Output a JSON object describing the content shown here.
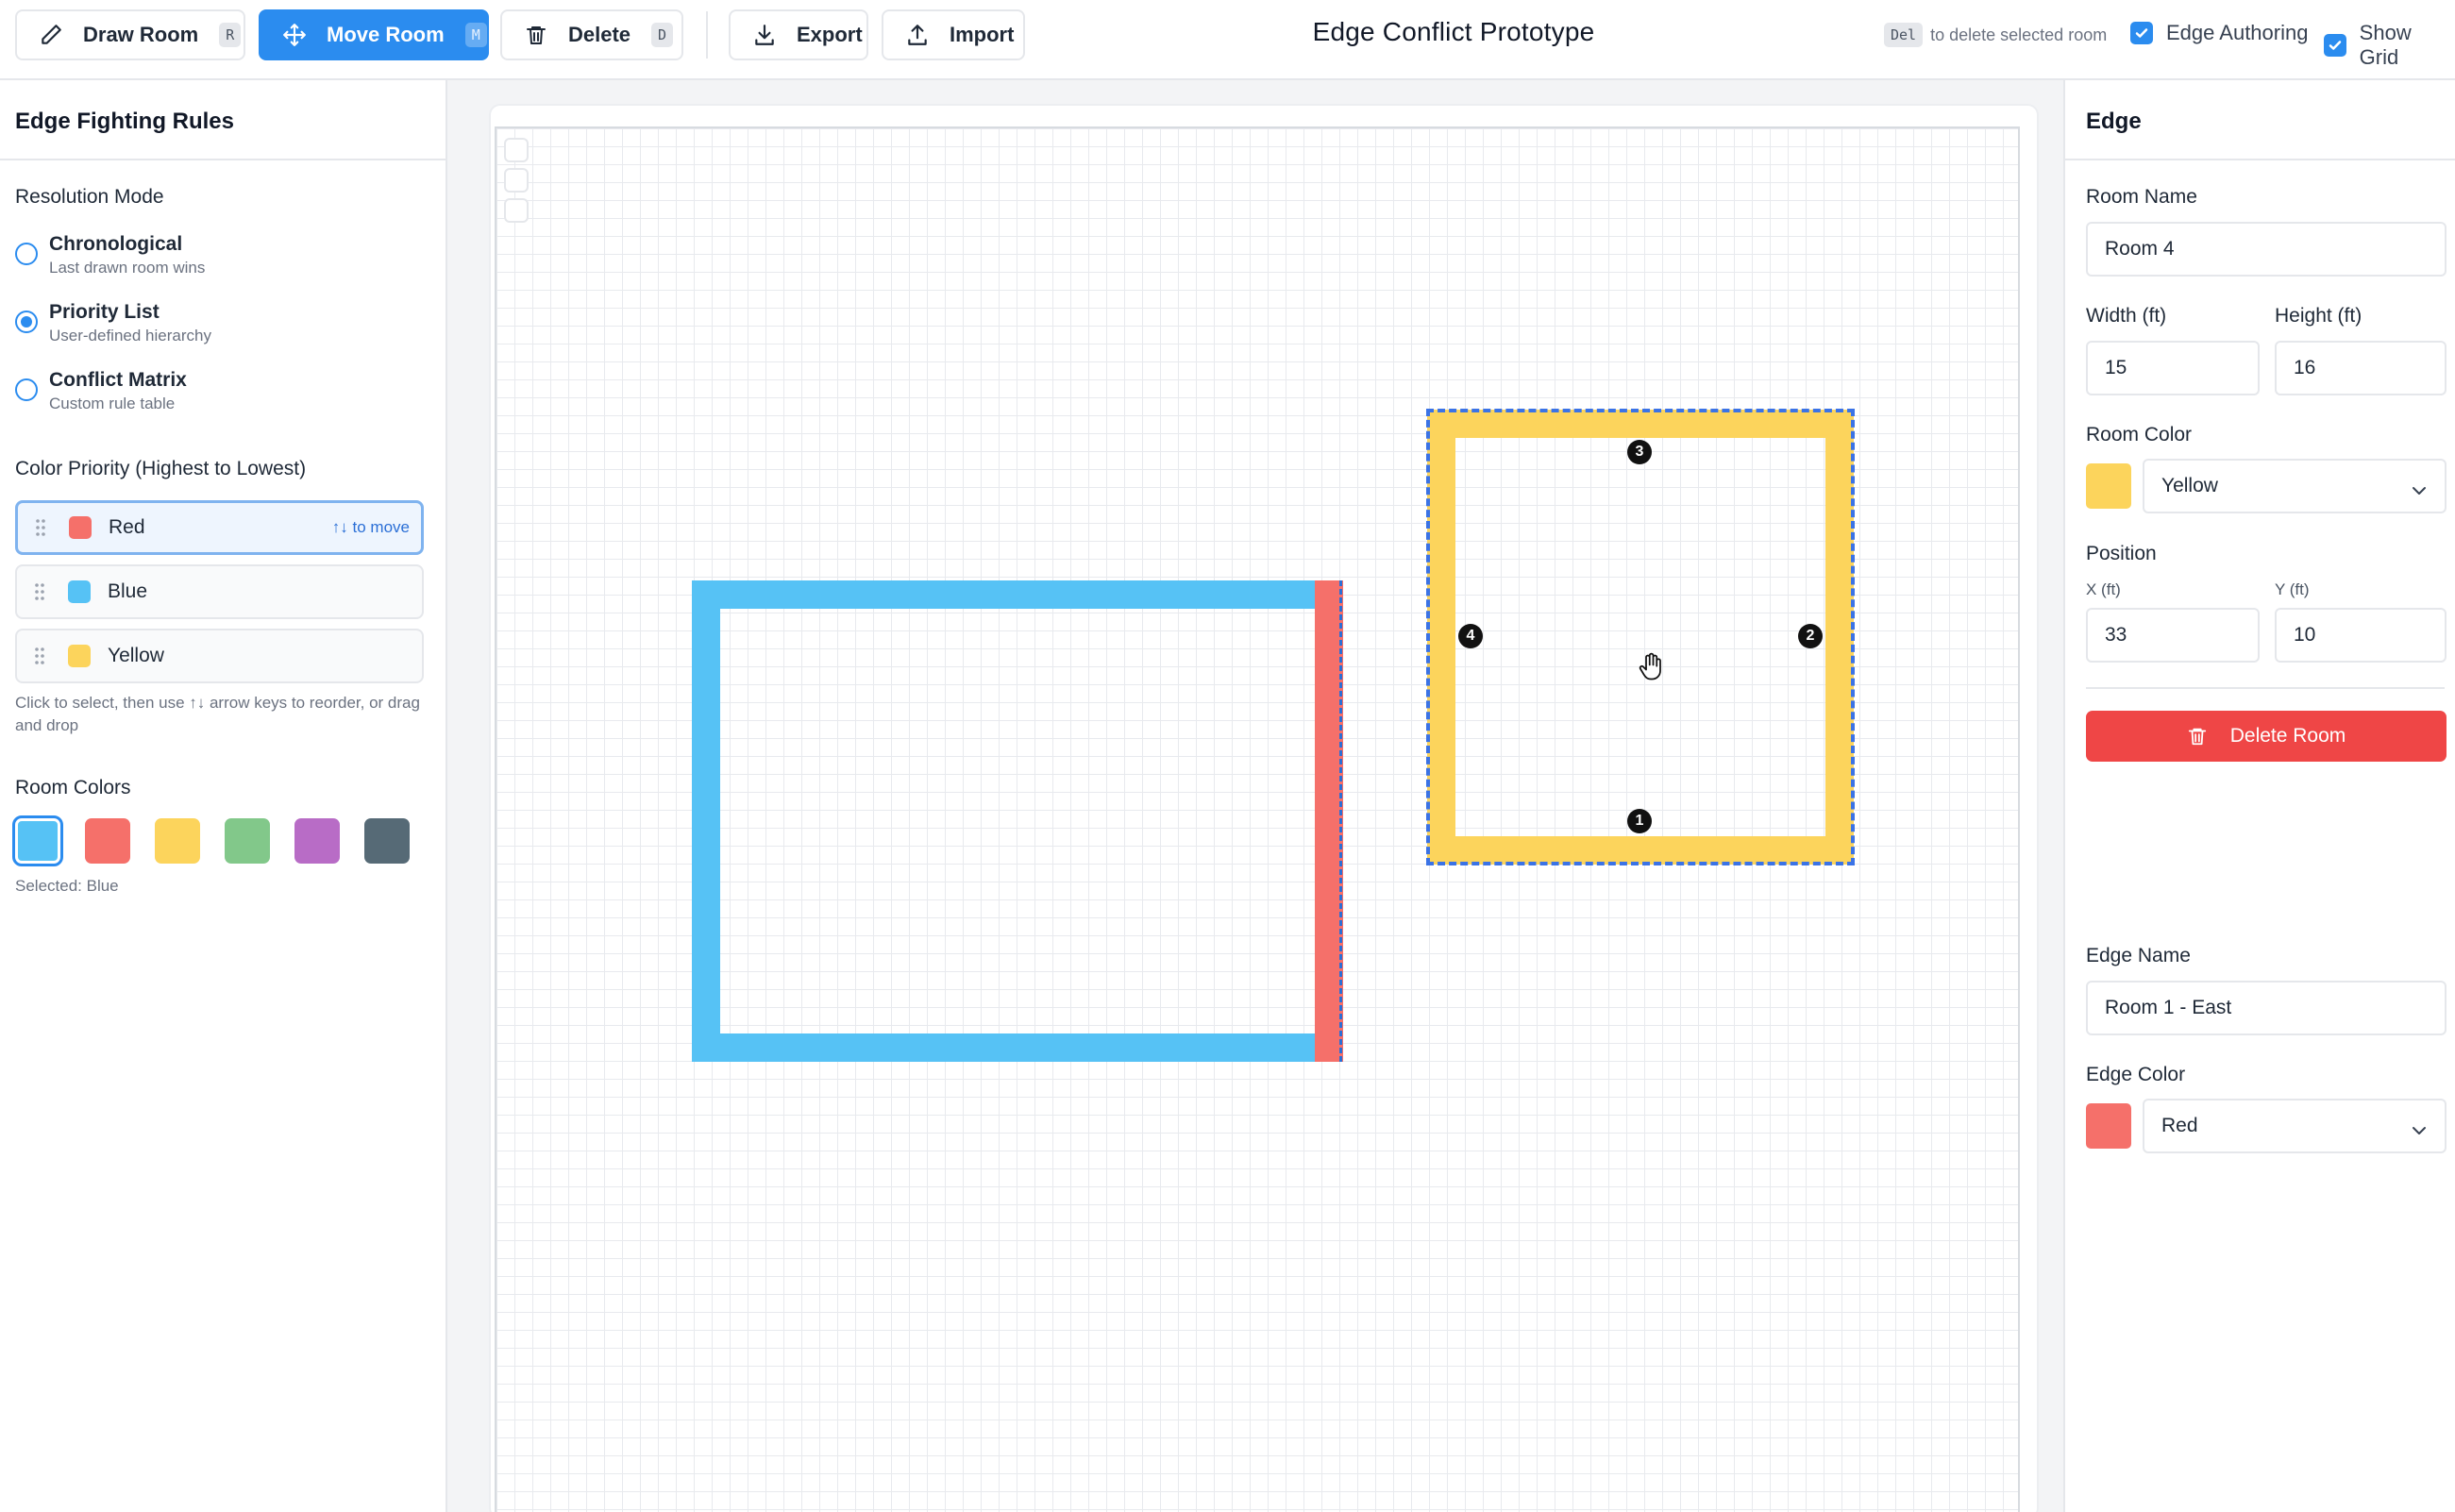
{
  "toolbar": {
    "draw_room": {
      "label": "Draw Room",
      "key": "R"
    },
    "move_room": {
      "label": "Move Room",
      "key": "M"
    },
    "delete": {
      "label": "Delete",
      "key": "D"
    },
    "export_label": "Export",
    "import_label": "Import",
    "title": "Edge Conflict Prototype",
    "delete_hint_key": "Del",
    "delete_hint_text": "to delete selected room",
    "edge_authoring_label": "Edge Authoring",
    "show_grid_label": "Show Grid",
    "active_tool": "move_room"
  },
  "left_panel": {
    "title": "Edge Fighting Rules",
    "resolution_mode_title": "Resolution Mode",
    "modes": [
      {
        "label": "Chronological",
        "desc": "Last drawn room wins",
        "selected": false
      },
      {
        "label": "Priority List",
        "desc": "User-defined hierarchy",
        "selected": true
      },
      {
        "label": "Conflict Matrix",
        "desc": "Custom rule table",
        "selected": false
      }
    ],
    "priority_title": "Color Priority (Highest to Lowest)",
    "priority": [
      {
        "label": "Red",
        "color": "#f5706a",
        "hint": "↑↓ to move"
      },
      {
        "label": "Blue",
        "color": "#56c2f5"
      },
      {
        "label": "Yellow",
        "color": "#fcd45c"
      }
    ],
    "help_text": "Click to select, then use ↑↓ arrow keys to reorder, or drag and drop",
    "room_colors_title": "Room Colors",
    "room_colors": [
      "#56c2f5",
      "#f5706a",
      "#fcd45c",
      "#82c88a",
      "#b86cc6",
      "#566a76"
    ],
    "selected_text": "Selected: Blue"
  },
  "canvas": {
    "yellow_edge_badges": [
      "3",
      "2",
      "1",
      "4"
    ],
    "blue_room_fill": "#56c2f5",
    "red_edge_fill": "#f5706a",
    "yellow_room_fill": "#fcd45c"
  },
  "right_panel": {
    "title": "Edge",
    "room_name_label": "Room Name",
    "room_name": "Room 4",
    "width_label": "Width (ft)",
    "width": "15",
    "height_label": "Height (ft)",
    "height": "16",
    "room_color_label": "Room Color",
    "room_color": "Yellow",
    "room_color_hex": "#fcd45c",
    "position_label": "Position",
    "x_label": "X (ft)",
    "x": "33",
    "y_label": "Y (ft)",
    "y": "10",
    "delete_room_label": "Delete Room",
    "edge_name_label": "Edge Name",
    "edge_name": "Room 1 - East",
    "edge_color_label": "Edge Color",
    "edge_color": "Red",
    "edge_color_hex": "#f5706a"
  }
}
